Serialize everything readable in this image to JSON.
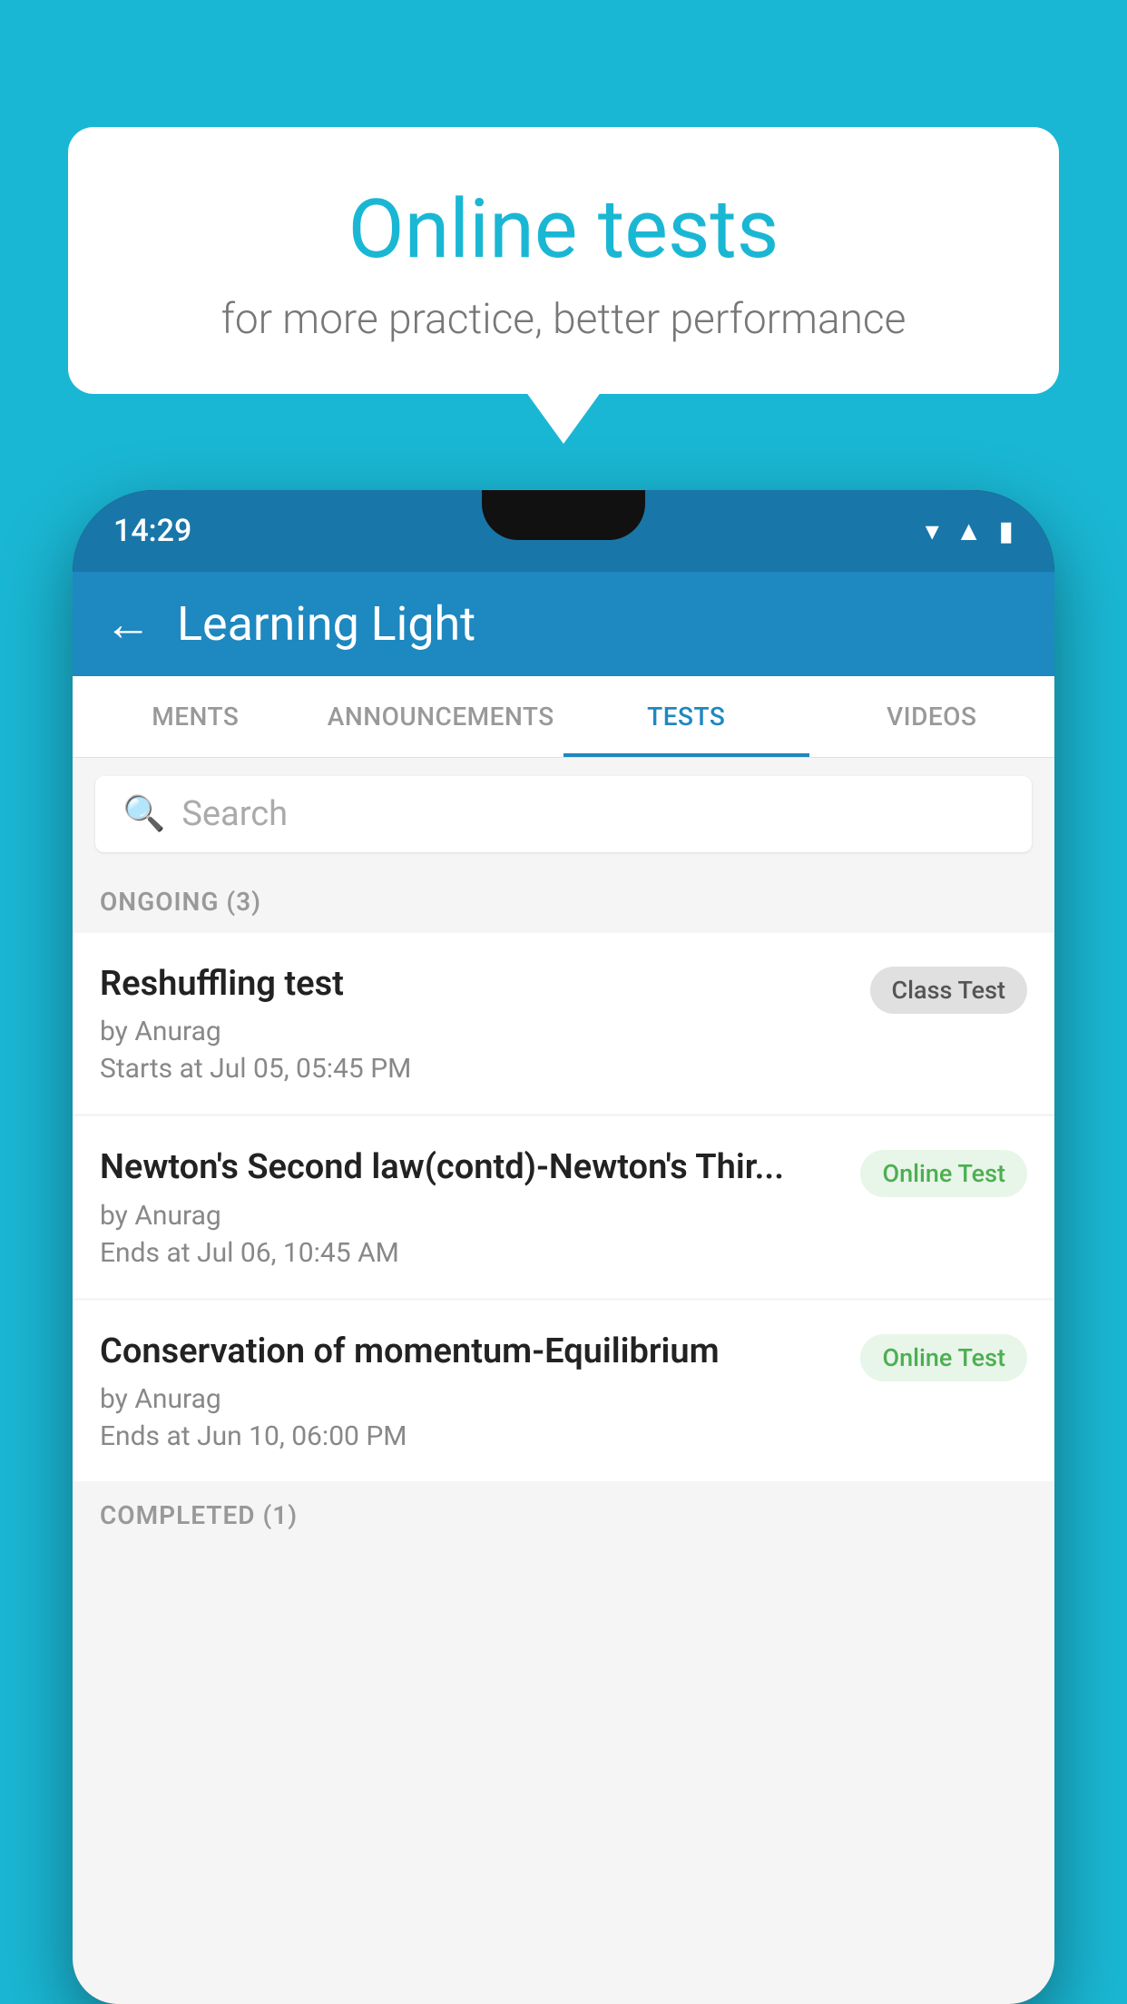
{
  "background_color": "#1ab7d4",
  "bubble": {
    "title": "Online tests",
    "subtitle": "for more practice, better performance"
  },
  "status_bar": {
    "time": "14:29",
    "icons": [
      "▼",
      "▲",
      "▌"
    ]
  },
  "app_bar": {
    "title": "Learning Light",
    "back_label": "←"
  },
  "tabs": [
    {
      "label": "MENTS",
      "active": false
    },
    {
      "label": "ANNOUNCEMENTS",
      "active": false
    },
    {
      "label": "TESTS",
      "active": true
    },
    {
      "label": "VIDEOS",
      "active": false
    }
  ],
  "search": {
    "placeholder": "Search"
  },
  "sections": [
    {
      "header": "ONGOING (3)",
      "items": [
        {
          "name": "Reshuffling test",
          "by": "by Anurag",
          "date": "Starts at  Jul 05, 05:45 PM",
          "badge": "Class Test",
          "badge_type": "class"
        },
        {
          "name": "Newton's Second law(contd)-Newton's Thir...",
          "by": "by Anurag",
          "date": "Ends at  Jul 06, 10:45 AM",
          "badge": "Online Test",
          "badge_type": "online"
        },
        {
          "name": "Conservation of momentum-Equilibrium",
          "by": "by Anurag",
          "date": "Ends at  Jun 10, 06:00 PM",
          "badge": "Online Test",
          "badge_type": "online"
        }
      ]
    },
    {
      "header": "COMPLETED (1)",
      "items": []
    }
  ]
}
